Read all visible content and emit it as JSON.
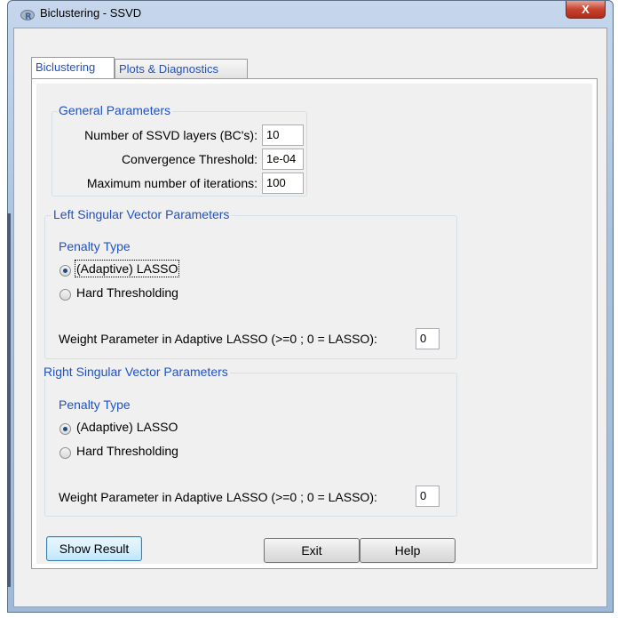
{
  "window": {
    "title": "Biclustering - SSVD",
    "close_label": "X"
  },
  "tabs": [
    {
      "label": "Biclustering",
      "active": true
    },
    {
      "label": "Plots & Diagnostics",
      "active": false
    }
  ],
  "general": {
    "legend": "General Parameters",
    "layers_label": "Number of SSVD layers (BC's):",
    "layers_value": "10",
    "conv_label": "Convergence Threshold:",
    "conv_value": "1e-04",
    "iter_label": "Maximum number of iterations:",
    "iter_value": "100"
  },
  "left": {
    "legend": "Left Singular Vector Parameters",
    "penalty_label": "Penalty Type",
    "opt_adaptive": "(Adaptive) LASSO",
    "opt_hard": "Hard Thresholding",
    "weight_label": "Weight Parameter in Adaptive LASSO (>=0 ; 0 = LASSO):",
    "weight_value": "0",
    "selected": "adaptive"
  },
  "right": {
    "legend": "Right Singular Vector Parameters",
    "penalty_label": "Penalty Type",
    "opt_adaptive": "(Adaptive) LASSO",
    "opt_hard": "Hard Thresholding",
    "weight_label": "Weight Parameter in Adaptive LASSO (>=0 ; 0 = LASSO):",
    "weight_value": "0",
    "selected": "adaptive"
  },
  "buttons": {
    "show": "Show Result",
    "exit": "Exit",
    "help": "Help"
  },
  "colors": {
    "accent": "#1f52c4",
    "titlebar": "#a9c2df",
    "close": "#c7432f"
  }
}
